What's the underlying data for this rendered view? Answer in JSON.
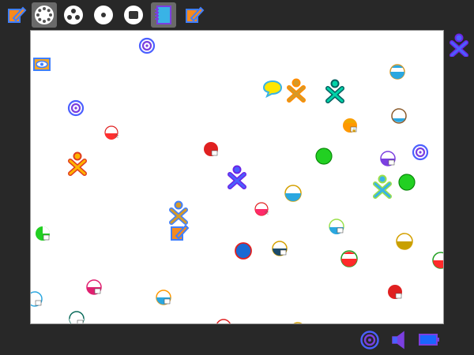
{
  "colors": {
    "frame": "#282828",
    "canvas_bg": "#ffffff",
    "active_tab": "#6a6a6a",
    "buddy_self_stroke": "#6a25e6",
    "buddy_self_fill": "#4b5fff",
    "accent_blue": "#3f7fff"
  },
  "toolbar": {
    "items": [
      {
        "name": "my-activity",
        "icon": "document-pencil-icon",
        "selected": false
      },
      {
        "name": "neighborhood-view",
        "icon": "neighborhood-dots-ring-icon",
        "selected": true
      },
      {
        "name": "group-view",
        "icon": "group-three-dots-icon",
        "selected": false
      },
      {
        "name": "home-view",
        "icon": "home-ring-icon",
        "selected": false
      },
      {
        "name": "activity-view",
        "icon": "activity-square-icon",
        "selected": false
      },
      {
        "name": "journal",
        "icon": "journal-notebook-icon",
        "selected": true
      },
      {
        "name": "write-activity",
        "icon": "document-pencil-icon",
        "selected": false
      }
    ]
  },
  "neighborhood": {
    "buddies": [
      {
        "name": "buddy-orange",
        "stroke": "#ff8c00",
        "fill": "#d49a2a",
        "icon": "buddy-xo-icon"
      },
      {
        "name": "buddy-dark-green",
        "stroke": "#005f5f",
        "fill": "#00d3a8",
        "icon": "buddy-xo-icon"
      },
      {
        "name": "buddy-red-orange",
        "stroke": "#e03c1e",
        "fill": "#ffb300",
        "icon": "buddy-xo-icon"
      },
      {
        "name": "buddy-purple",
        "stroke": "#6a25e6",
        "fill": "#4b5fff",
        "icon": "buddy-xo-icon"
      },
      {
        "name": "buddy-lime",
        "stroke": "#9be04a",
        "fill": "#39b3e6",
        "icon": "buddy-xo-icon"
      },
      {
        "name": "buddy-blue-orange",
        "stroke": "#3f7fff",
        "fill": "#d49a2a",
        "icon": "buddy-xo-icon"
      }
    ],
    "access_points": [
      {
        "name": "wifi-network",
        "icon": "wireless-network-icon",
        "locked": false
      }
    ],
    "activities": [
      {
        "name": "chat-activity",
        "icon": "chat-bubble-icon"
      },
      {
        "name": "write-shared-activity",
        "icon": "document-pencil-icon"
      },
      {
        "name": "mesh-network-1",
        "icon": "mesh-target-icon"
      },
      {
        "name": "mesh-network-2",
        "icon": "mesh-target-icon"
      },
      {
        "name": "mesh-network-3",
        "icon": "mesh-target-icon"
      },
      {
        "name": "eye-view",
        "icon": "eye-icon"
      }
    ]
  },
  "side_panel": {
    "self_icon": "buddy-xo-icon"
  },
  "tray": {
    "items": [
      {
        "name": "network-status",
        "icon": "mesh-target-icon"
      },
      {
        "name": "volume",
        "icon": "speaker-icon"
      },
      {
        "name": "battery",
        "icon": "battery-icon"
      }
    ]
  }
}
